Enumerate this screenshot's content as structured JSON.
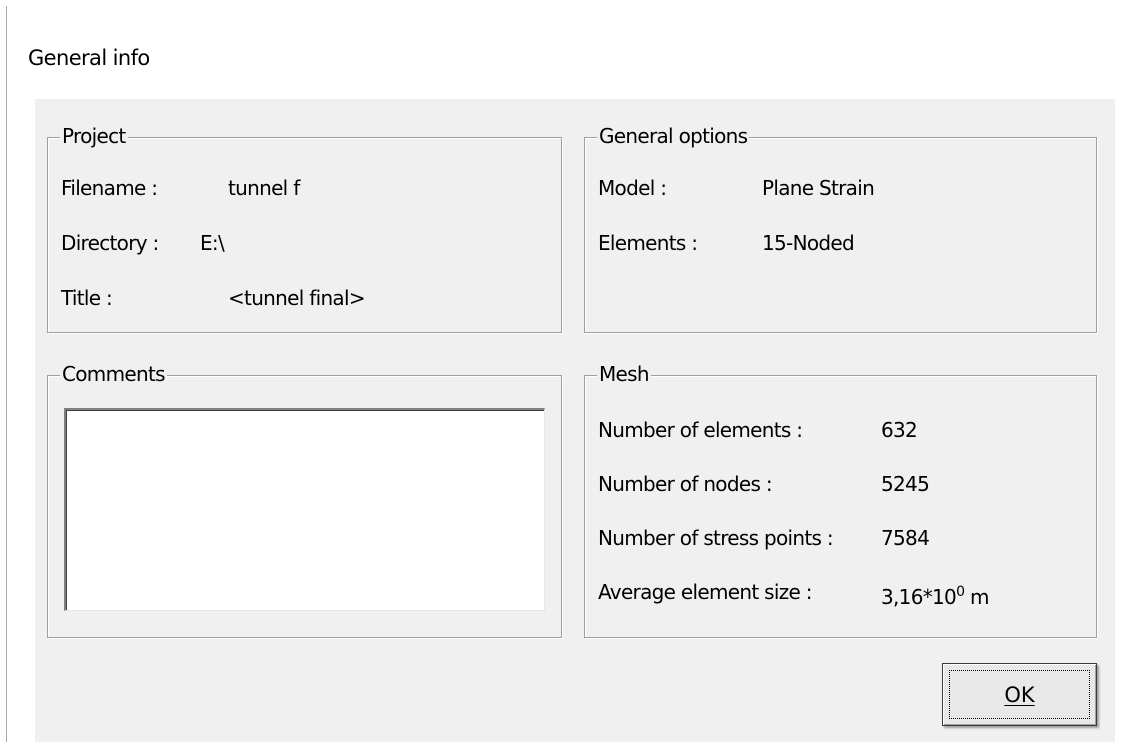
{
  "window": {
    "title": "General info"
  },
  "project": {
    "legend": "Project",
    "rows": [
      {
        "label": "Filename :",
        "value": "tunnel f"
      },
      {
        "label": "Directory :",
        "value": "E:\\"
      },
      {
        "label": "Title :",
        "value": "<tunnel final>"
      }
    ]
  },
  "general_options": {
    "legend": "General options",
    "rows": [
      {
        "label": "Model :",
        "value": "Plane Strain"
      },
      {
        "label": "Elements :",
        "value": "15-Noded"
      }
    ]
  },
  "comments": {
    "legend": "Comments",
    "value": ""
  },
  "mesh": {
    "legend": "Mesh",
    "rows": [
      {
        "label": "Number of elements :",
        "value": "632"
      },
      {
        "label": "Number of nodes :",
        "value": "5245"
      },
      {
        "label": "Number of stress points :",
        "value": "7584"
      }
    ],
    "avg_size": {
      "label": "Average element size :",
      "mantissa": "3,16*10",
      "exponent": "0",
      "unit": "m"
    }
  },
  "buttons": {
    "ok_label": "OK"
  }
}
